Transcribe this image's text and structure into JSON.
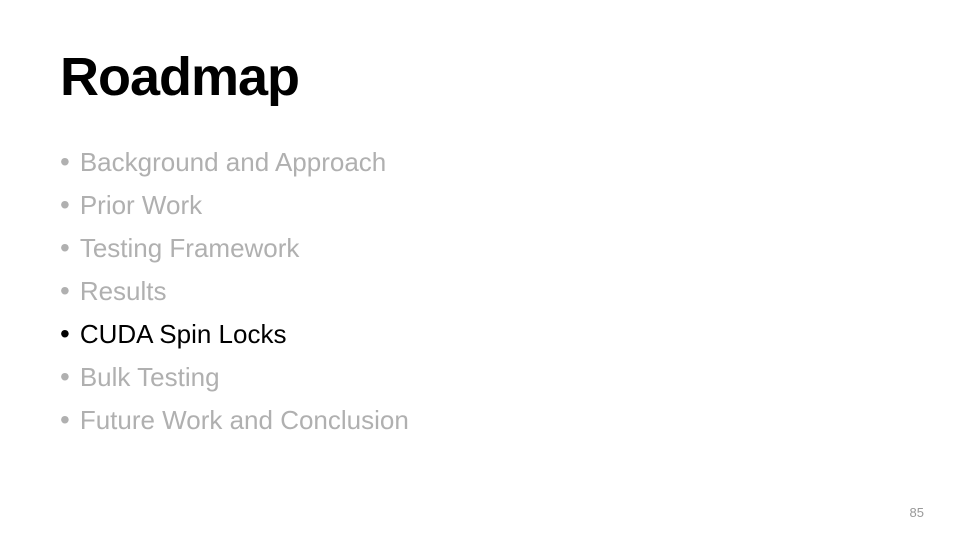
{
  "slide": {
    "title": "Roadmap",
    "items": [
      {
        "label": "Background and Approach",
        "active": false
      },
      {
        "label": "Prior Work",
        "active": false
      },
      {
        "label": "Testing Framework",
        "active": false
      },
      {
        "label": "Results",
        "active": false
      },
      {
        "label": "CUDA Spin Locks",
        "active": true
      },
      {
        "label": "Bulk Testing",
        "active": false
      },
      {
        "label": "Future Work and Conclusion",
        "active": false
      }
    ],
    "page_number": "85"
  }
}
